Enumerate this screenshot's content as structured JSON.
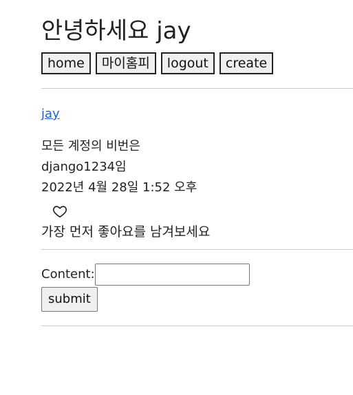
{
  "header": {
    "greeting": "안녕하세요 jay"
  },
  "nav": {
    "home": "home",
    "mypage": "마이홈피",
    "logout": "logout",
    "create": "create"
  },
  "post": {
    "author": "jay",
    "lines": [
      "모든 계정의 비번은",
      "django1234임",
      "2022년 4월 28일 1:52 오후"
    ],
    "like_icon": "heart-outline-icon",
    "like_message": "가장 먼저 좋아요를 남겨보세요"
  },
  "comment_form": {
    "label": "Content:",
    "value": "",
    "submit_label": "submit"
  }
}
